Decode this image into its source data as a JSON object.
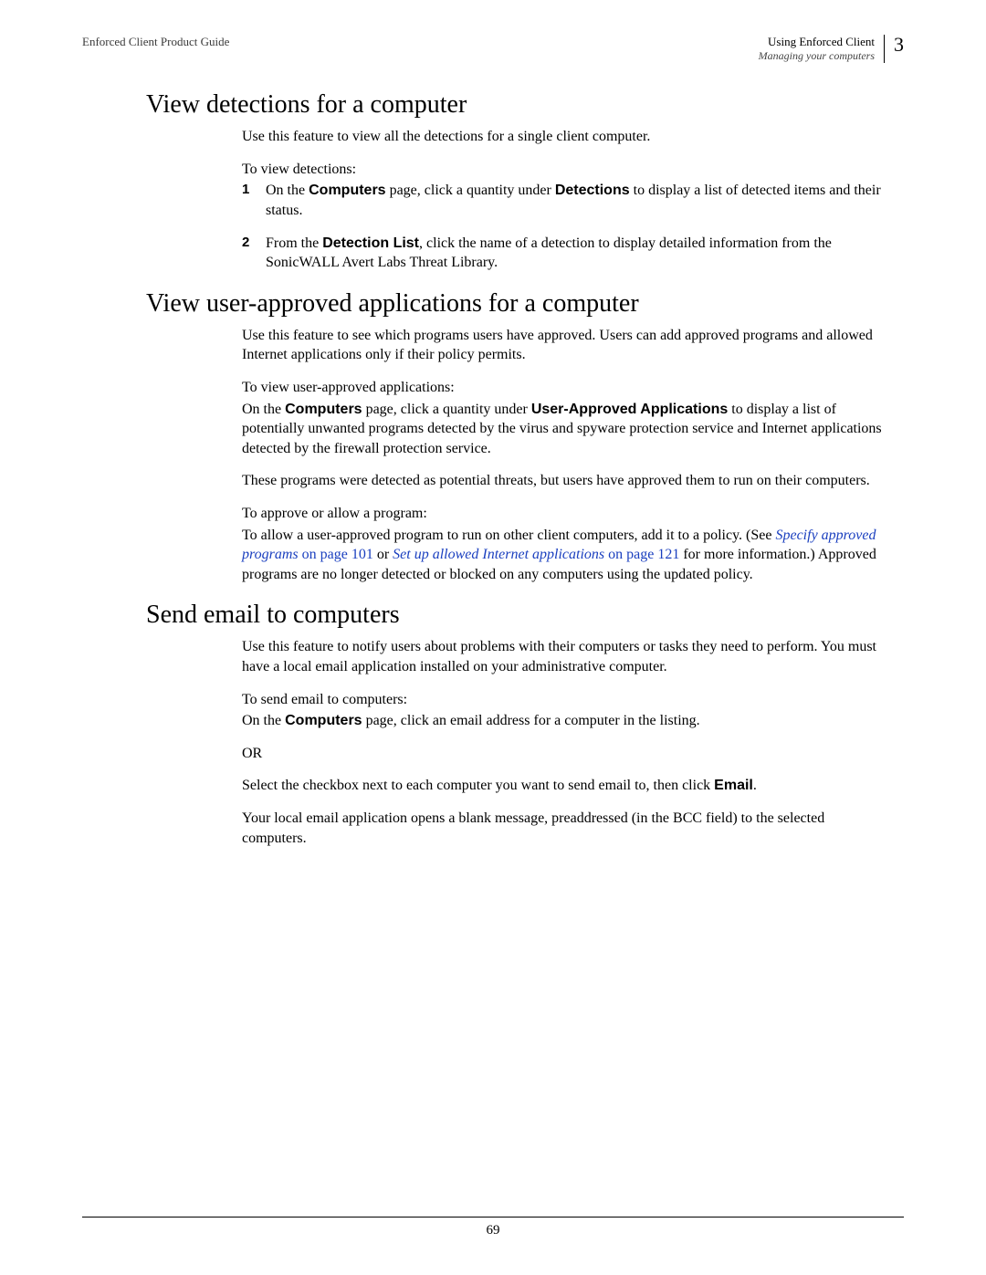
{
  "header": {
    "left": "Enforced Client Product Guide",
    "right_line1": "Using Enforced Client",
    "right_line2": "Managing your computers",
    "chapter_number": "3"
  },
  "sections": {
    "detections": {
      "title": "View detections for a computer",
      "intro": "Use this feature to view all the detections for a single client computer.",
      "howto_label": "To view detections:",
      "step1_a": "On the ",
      "step1_b_bold": "Computers",
      "step1_c": " page, click a quantity under ",
      "step1_d_bold": "Detections",
      "step1_e": " to display a list of detected items and their status.",
      "step2_a": "From the ",
      "step2_b_bold": "Detection List",
      "step2_c": ", click the name of a detection to display detailed information from the SonicWALL Avert Labs Threat Library."
    },
    "approved": {
      "title": "View user-approved applications for a computer",
      "intro": "Use this feature to see which programs users have approved. Users can add approved programs and allowed Internet applications only if their policy permits.",
      "howto_label": "To view user-approved applications:",
      "p1_a": "On the ",
      "p1_b_bold": "Computers",
      "p1_c": " page, click a quantity under ",
      "p1_d_bold": "User-Approved Applications",
      "p1_e": " to display a list of potentially unwanted programs detected by the virus and spyware protection service and Internet applications detected by the firewall protection service.",
      "p2": "These programs were detected as potential threats, but users have approved them to run on their computers.",
      "howto2_label": "To approve or allow a program:",
      "p3_a": "To allow a user-approved program to run on other client computers, add it to a policy. (See ",
      "link1_text": "Specify approved programs",
      "link1_suffix": " on page 101",
      "p3_or": " or ",
      "link2_text": "Set up allowed Internet applications",
      "link2_suffix": " on page 121",
      "p3_b": " for more information.) Approved programs are no longer detected or blocked on any computers using the updated policy."
    },
    "email": {
      "title": "Send email to computers",
      "intro": "Use this feature to notify users about problems with their computers or tasks they need to perform. You must have a local email application installed on your administrative computer.",
      "howto_label": "To send email to computers:",
      "p1_a": "On the ",
      "p1_b_bold": "Computers",
      "p1_c": " page, click an email address for a computer in the listing.",
      "or_text": "OR",
      "p2_a": "Select the checkbox next to each computer you want to send email to, then click ",
      "p2_b_bold": "Email",
      "p2_c": ".",
      "p3": "Your local email application opens a blank message, preaddressed (in the BCC field) to the selected computers."
    }
  },
  "footer": {
    "page_number": "69"
  }
}
